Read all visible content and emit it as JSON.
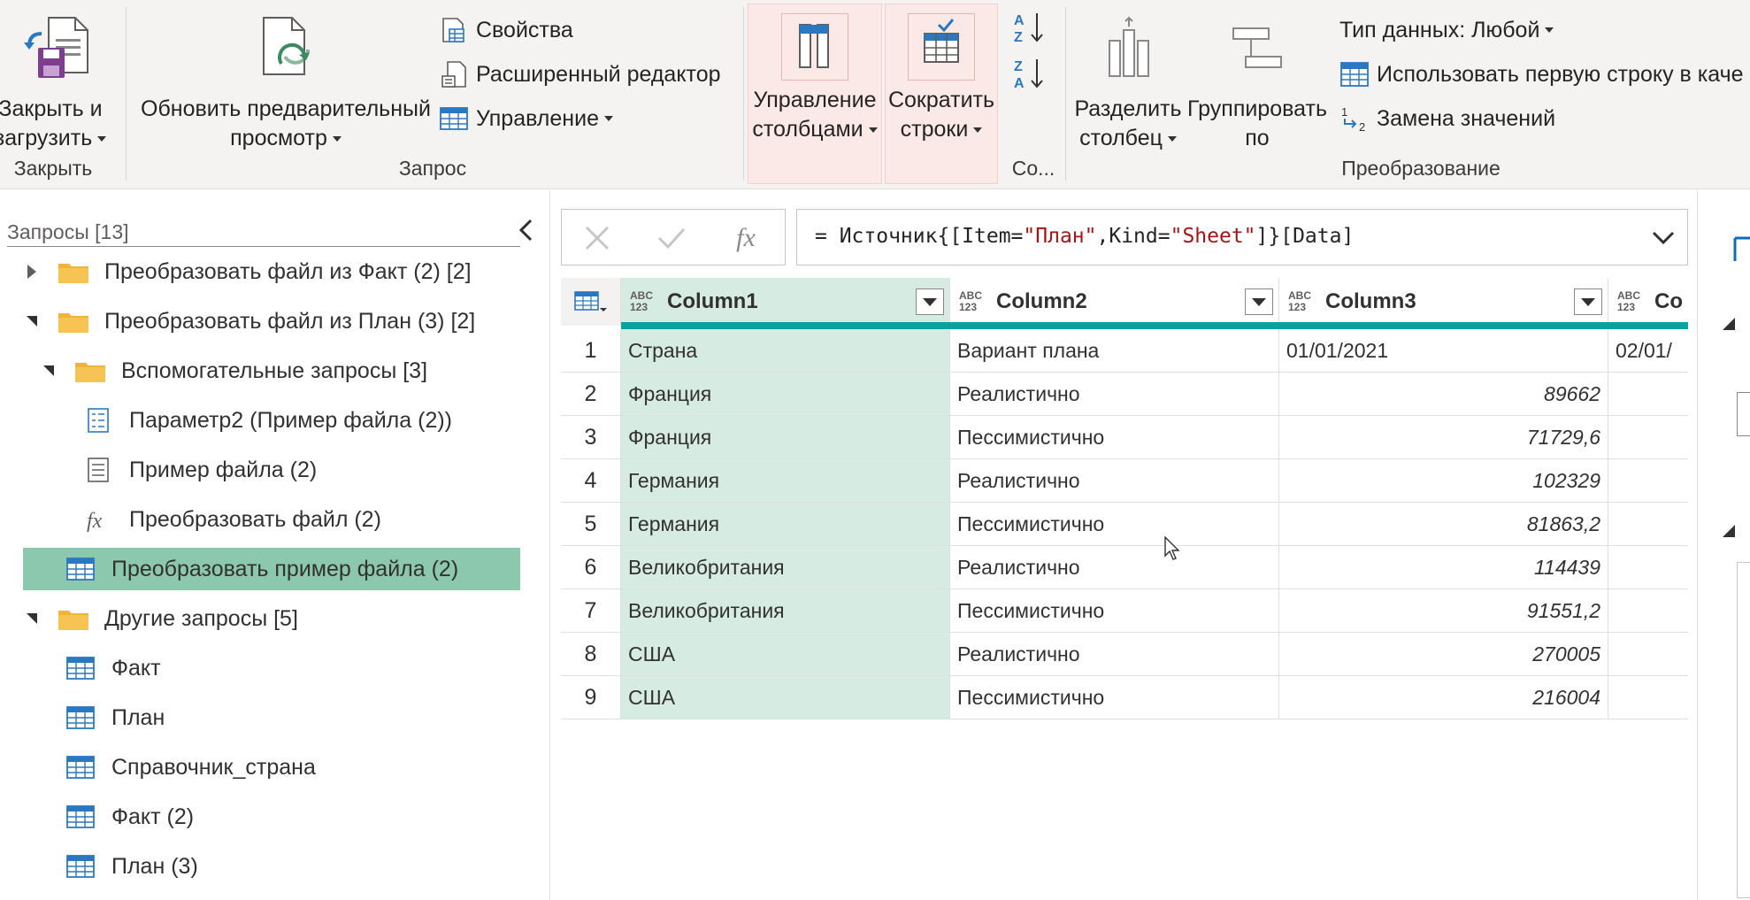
{
  "ribbon": {
    "close_group": {
      "label": "Закрыть",
      "close_load_line1": "Закрыть и",
      "close_load_line2": "загрузить"
    },
    "query_group": {
      "label": "Запрос",
      "refresh_line1": "Обновить предварительный",
      "refresh_line2": "просмотр",
      "properties": "Свойства",
      "advanced_editor": "Расширенный редактор",
      "manage": "Управление"
    },
    "manage_columns": {
      "line1": "Управление",
      "line2": "столбцами"
    },
    "reduce_rows": {
      "line1": "Сократить",
      "line2": "строки"
    },
    "sort_group": {
      "label": "Со..."
    },
    "transform_group": {
      "label": "Преобразование",
      "split_line1": "Разделить",
      "split_line2": "столбец",
      "group_line1": "Группировать",
      "group_line2": "по",
      "data_type": "Тип данных: Любой",
      "use_first_row": "Использовать первую строку в каче",
      "replace_values": "Замена значений"
    },
    "highlight_color": "#fbe9e8"
  },
  "queries_panel": {
    "title": "Запросы [13]",
    "items": [
      {
        "label": "Преобразовать файл из Факт (2) [2]",
        "icon": "folder-icon",
        "expander": "collapsed"
      },
      {
        "label": "Преобразовать файл из План (3) [2]",
        "icon": "folder-icon",
        "expander": "expanded"
      },
      {
        "label": "Вспомогательные запросы [3]",
        "icon": "folder-icon",
        "expander": "expanded"
      },
      {
        "label": "Параметр2 (Пример файла (2))",
        "icon": "parameter-icon"
      },
      {
        "label": "Пример файла (2)",
        "icon": "document-icon"
      },
      {
        "label": "Преобразовать файл (2)",
        "icon": "function-icon"
      },
      {
        "label": "Преобразовать пример файла (2)",
        "icon": "table-icon",
        "selected": true
      },
      {
        "label": "Другие запросы [5]",
        "icon": "folder-icon",
        "expander": "expanded"
      },
      {
        "label": "Факт",
        "icon": "table-icon"
      },
      {
        "label": "План",
        "icon": "table-icon"
      },
      {
        "label": "Справочник_страна",
        "icon": "table-icon"
      },
      {
        "label": "Факт (2)",
        "icon": "table-icon"
      },
      {
        "label": "План (3)",
        "icon": "table-icon"
      }
    ],
    "selected_color": "#8cc8ae"
  },
  "formula_bar": {
    "prefix": "= Источник{[Item=",
    "str1": "\"План\"",
    "mid": ",Kind=",
    "str2": "\"Sheet\"",
    "suffix": "]}[Data]",
    "fx": "fx"
  },
  "grid": {
    "type_label_top": "ABC",
    "type_label_bottom": "123",
    "columns": [
      "Column1",
      "Column2",
      "Column3",
      "Co"
    ],
    "quality_color": "#08a3a0",
    "rows": [
      {
        "n": "1",
        "c1": "Страна",
        "c2": "Вариант плана",
        "c3": "01/01/2021",
        "c4": "02/01/"
      },
      {
        "n": "2",
        "c1": "Франция",
        "c2": "Реалистично",
        "c3": "89662",
        "c4": ""
      },
      {
        "n": "3",
        "c1": "Франция",
        "c2": "Пессимистично",
        "c3": "71729,6",
        "c4": ""
      },
      {
        "n": "4",
        "c1": "Германия",
        "c2": "Реалистично",
        "c3": "102329",
        "c4": ""
      },
      {
        "n": "5",
        "c1": "Германия",
        "c2": "Пессимистично",
        "c3": "81863,2",
        "c4": ""
      },
      {
        "n": "6",
        "c1": "Великобритания",
        "c2": "Реалистично",
        "c3": "114439",
        "c4": ""
      },
      {
        "n": "7",
        "c1": "Великобритания",
        "c2": "Пессимистично",
        "c3": "91551,2",
        "c4": ""
      },
      {
        "n": "8",
        "c1": "США",
        "c2": "Реалистично",
        "c3": "270005",
        "c4": ""
      },
      {
        "n": "9",
        "c1": "США",
        "c2": "Пессимистично",
        "c3": "216004",
        "c4": ""
      }
    ]
  }
}
